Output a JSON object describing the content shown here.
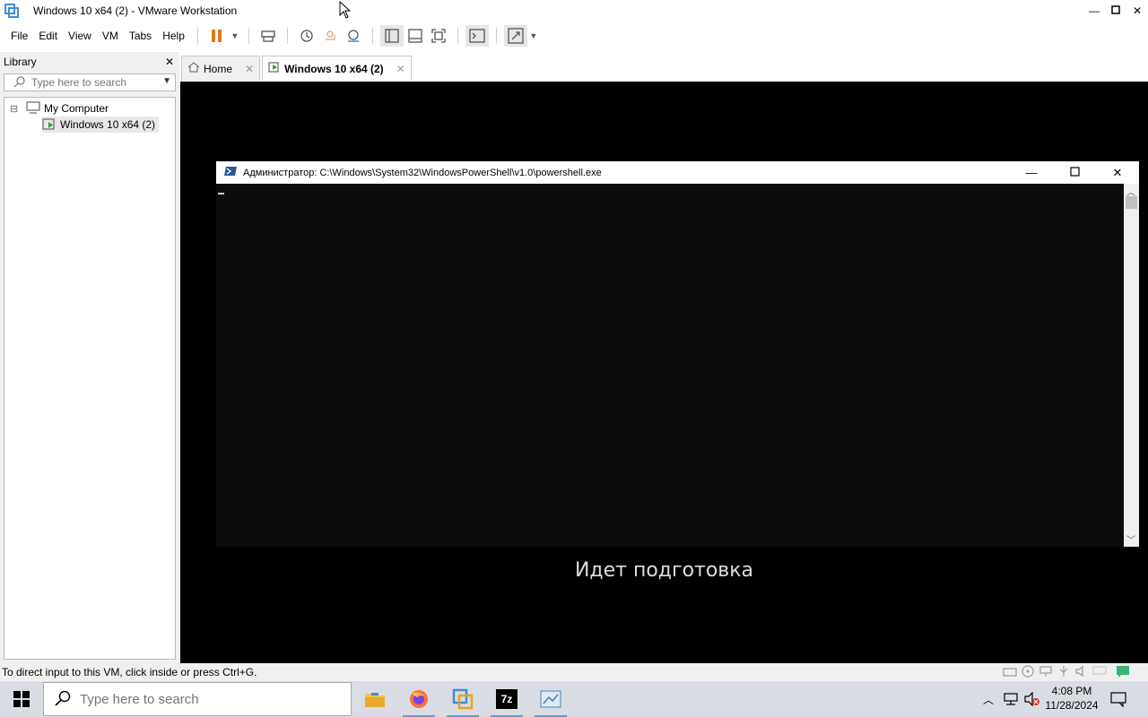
{
  "window": {
    "title": "Windows 10 x64 (2) - VMware Workstation",
    "icon": "vmware-app-icon",
    "controls": [
      "minimize-icon",
      "maximize-icon",
      "close-icon"
    ]
  },
  "menu": {
    "items": [
      "File",
      "Edit",
      "View",
      "VM",
      "Tabs",
      "Help"
    ]
  },
  "library": {
    "title": "Library",
    "close_label": "✕",
    "search_placeholder": "Type here to search",
    "tree": {
      "root_label": "My Computer",
      "expand_symbol": "⊟",
      "child_label": "Windows 10 x64 (2)"
    }
  },
  "tabs": [
    {
      "label": "Home",
      "close": "✕"
    },
    {
      "label": "Windows 10 x64 (2)",
      "close": "✕"
    }
  ],
  "powershell": {
    "title": "Администратор: C:\\Windows\\System32\\WindowsPowerShell\\v1.0\\powershell.exe",
    "controls": [
      "minimize-icon",
      "maximize-icon",
      "close-icon"
    ]
  },
  "vm_screen": {
    "status_text": "Идет подготовка"
  },
  "statusbar": {
    "hint": "To direct input to this VM, click inside or press Ctrl+G."
  },
  "taskbar": {
    "search_placeholder": "Type here to search",
    "apps": [
      "file-explorer-icon",
      "firefox-icon",
      "vmware-icon",
      "7zip-icon",
      "paint-icon"
    ],
    "sevenzip_label": "7z",
    "clock_time": "4:08 PM",
    "clock_date": "11/28/2024"
  },
  "colors": {
    "accent": "#5d9bd6",
    "pause_orange": "#e07a1f",
    "vm_background": "#000000",
    "console_background": "#0c0c0c"
  }
}
